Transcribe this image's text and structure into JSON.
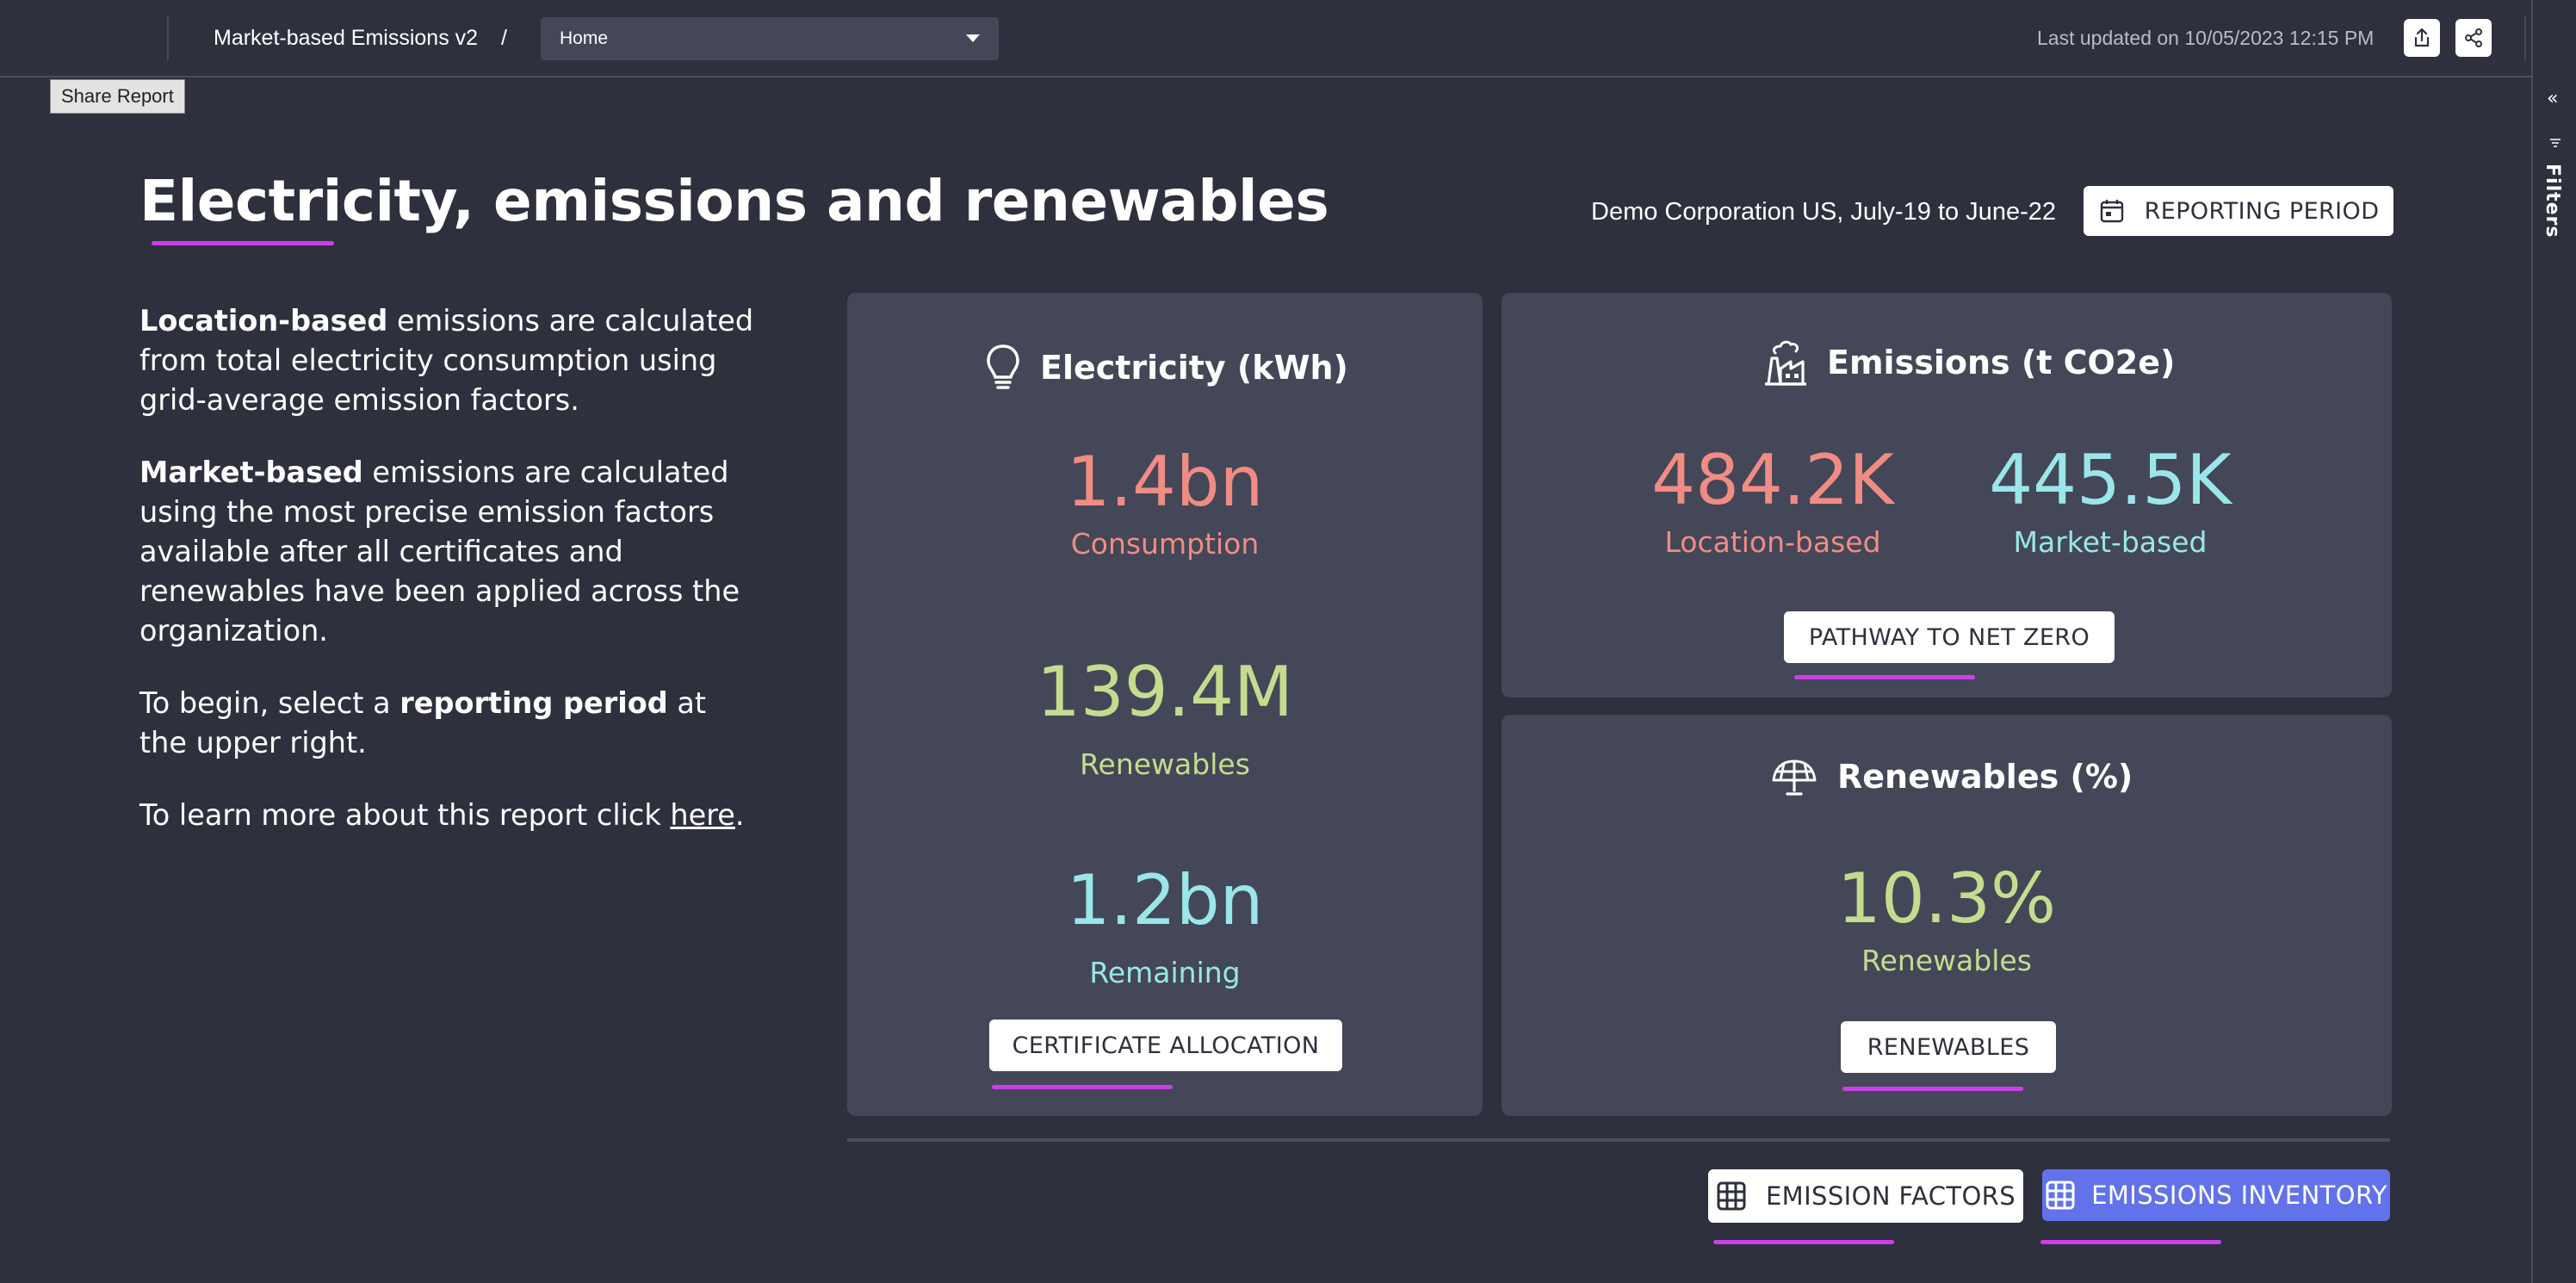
{
  "topbar": {
    "report_name": "Market-based Emissions v2",
    "crumb_separator": "/",
    "page_selector": {
      "value": "Home"
    },
    "last_updated": "Last updated on 10/05/2023 12:15 PM",
    "export_icon": "export-icon",
    "share_icon": "share-icon"
  },
  "tooltip": "Share Report",
  "filters_pane": {
    "label": "Filters",
    "collapse_icon": "double-chevron-left-icon"
  },
  "heading": {
    "title": "Electricity, emissions and renewables",
    "org_period": "Demo Corporation US, July-19 to June-22",
    "reporting_period_button": "REPORTING PERIOD"
  },
  "description": {
    "p1_bold": "Location-based",
    "p1_rest": " emissions are calculated from total electricity consumption using grid-average emission factors.",
    "p2_bold": "Market-based",
    "p2_rest": " emissions are calculated using the most precise emission factors available after all certificates and renewables have been applied across the organization.",
    "p3_pre": "To begin, select a ",
    "p3_bold": "reporting period",
    "p3_post": " at the upper right.",
    "p4_pre": "To learn more about this report click ",
    "p4_link": "here",
    "p4_post": "."
  },
  "electricity_card": {
    "title": "Electricity (kWh)",
    "icon": "lightbulb-icon",
    "consumption": {
      "value": "1.4bn",
      "label": "Consumption"
    },
    "renewables": {
      "value": "139.4M",
      "label": "Renewables"
    },
    "remaining": {
      "value": "1.2bn",
      "label": "Remaining"
    },
    "button": "CERTIFICATE ALLOCATION"
  },
  "emissions_card": {
    "title": "Emissions (t CO2e)",
    "icon": "factory-icon",
    "location": {
      "value": "484.2K",
      "label": "Location-based"
    },
    "market": {
      "value": "445.5K",
      "label": "Market-based"
    },
    "button": "PATHWAY TO NET ZERO"
  },
  "renewables_card": {
    "title": "Renewables (%)",
    "icon": "solar-panel-icon",
    "share": {
      "value": "10.3%",
      "label": "Renewables"
    },
    "button": "RENEWABLES"
  },
  "footer_buttons": {
    "emission_factors": "EMISSION FACTORS",
    "emissions_inventory": "EMISSIONS INVENTORY"
  },
  "colors": {
    "background": "#2e303d",
    "card": "#444757",
    "salmon": "#f08c84",
    "green": "#c5dc8f",
    "cyan": "#9ae6ea",
    "accent_underline": "#cc3fe8",
    "primary_button": "#6272ea"
  }
}
